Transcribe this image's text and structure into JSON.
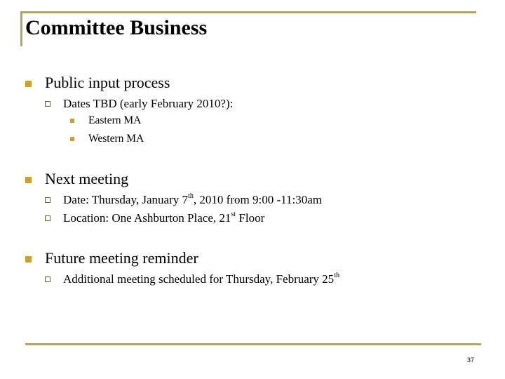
{
  "slide": {
    "title": "Committee Business",
    "page_number": "37",
    "colors": {
      "accent_rule": "#b2a75a",
      "primary_bullet": "#c9a227",
      "secondary_bullet_border": "#4f6e2d"
    }
  },
  "bullets": [
    {
      "text": "Public input process",
      "children": [
        {
          "text": "Dates TBD (early February 2010?):",
          "children": [
            {
              "text": "Eastern MA"
            },
            {
              "text": "Western MA"
            }
          ]
        }
      ]
    },
    {
      "text": "Next meeting",
      "children": [
        {
          "pre": "Date:  Thursday, January 7",
          "sup": "th",
          "post": ", 2010 from 9:00 -11:30am"
        },
        {
          "pre": "Location:  One Ashburton Place, 21",
          "sup": "st",
          "post": " Floor"
        }
      ]
    },
    {
      "text": "Future meeting reminder",
      "children": [
        {
          "pre": "Additional meeting scheduled for Thursday, February 25",
          "sup": "th",
          "post": ""
        }
      ]
    }
  ]
}
